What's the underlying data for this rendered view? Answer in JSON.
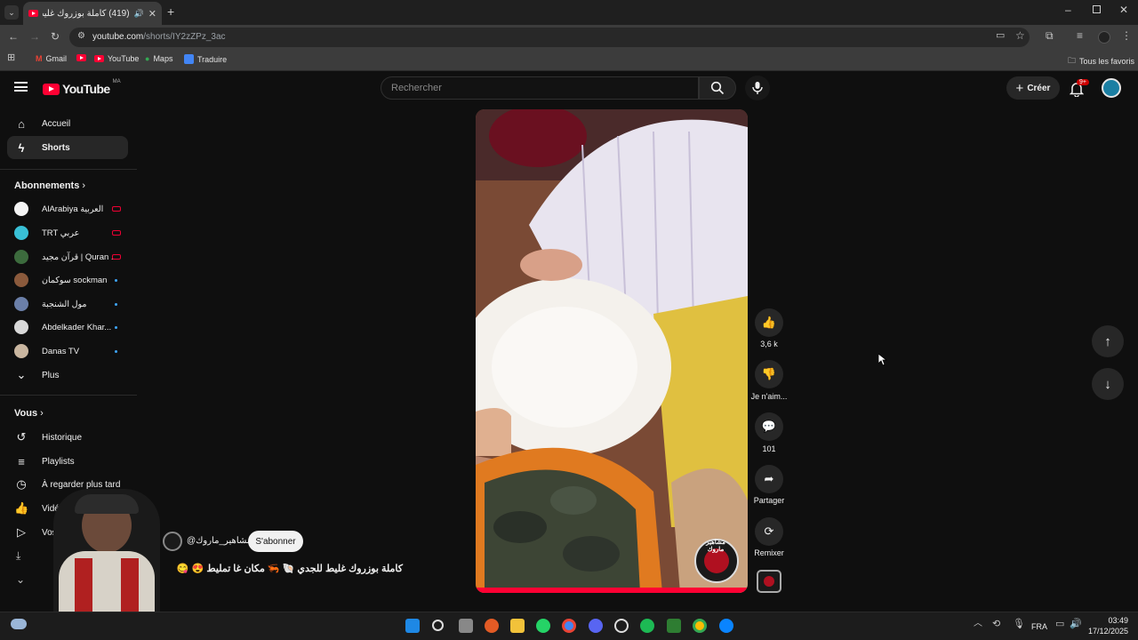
{
  "browser": {
    "tab_title": "(419) كاملة بوزروك غليط للجـ",
    "url_host": "youtube.com",
    "url_path": "/shorts/IY2zZPz_3ac",
    "bookmarks": [
      "Gmail",
      "YouTube",
      "Maps",
      "Traduire"
    ],
    "all_bookmarks": "Tous les favoris"
  },
  "header": {
    "logo": "YouTube",
    "region": "MA",
    "search_placeholder": "Rechercher",
    "create_label": "Créer",
    "notif_count": "9+"
  },
  "sidebar": {
    "main": [
      {
        "label": "Accueil",
        "icon": "home-icon"
      },
      {
        "label": "Shorts",
        "icon": "shorts-icon"
      }
    ],
    "subscriptions_title": "Abonnements",
    "subscriptions": [
      {
        "label": "AlArabiya العربية",
        "status": "live",
        "color": "#f4f4f4"
      },
      {
        "label": "TRT عربي",
        "status": "live",
        "color": "#39c0d6"
      },
      {
        "label": "قرآن مجيد | Quran ...",
        "status": "live",
        "color": "#3c6b3d"
      },
      {
        "label": "سوكمان sockman",
        "status": "new",
        "color": "#8b5a3c"
      },
      {
        "label": "مول الشنجبة",
        "status": "new",
        "color": "#6b7fa8"
      },
      {
        "label": "Abdelkader Khar...",
        "status": "new",
        "color": "#d8d8d8"
      },
      {
        "label": "Danas TV",
        "status": "new",
        "color": "#c9b6a0"
      }
    ],
    "more_label": "Plus",
    "you_title": "Vous",
    "you_items": [
      {
        "label": "Historique",
        "icon": "history-icon"
      },
      {
        "label": "Playlists",
        "icon": "playlist-icon"
      },
      {
        "label": "À regarder plus tard",
        "icon": "clock-icon"
      },
      {
        "label": "Vidéos \"J'aime\"",
        "icon": "thumb-up-icon"
      },
      {
        "label": "Vos vidéos",
        "icon": "video-icon"
      }
    ]
  },
  "short": {
    "channel": "@مشاهير_ماروك",
    "subscribe_label": "S'abonner",
    "caption": "كاملة بوزروك غليط للجدي 🐚 🦐 مكان غا تمليط 😍 😋",
    "likes": "3,6 k",
    "dislike_label": "Je n'aim...",
    "comments": "101",
    "share_label": "Partager",
    "remix_label": "Remixer",
    "watermark": "مشاهير ماروك"
  },
  "taskbar": {
    "lang": "FRA",
    "time": "03:49",
    "date": "17/12/2025"
  },
  "colors": {
    "brand_red": "#ff0033",
    "bg": "#0f0f0f",
    "accent_blue": "#3ea6ff"
  }
}
